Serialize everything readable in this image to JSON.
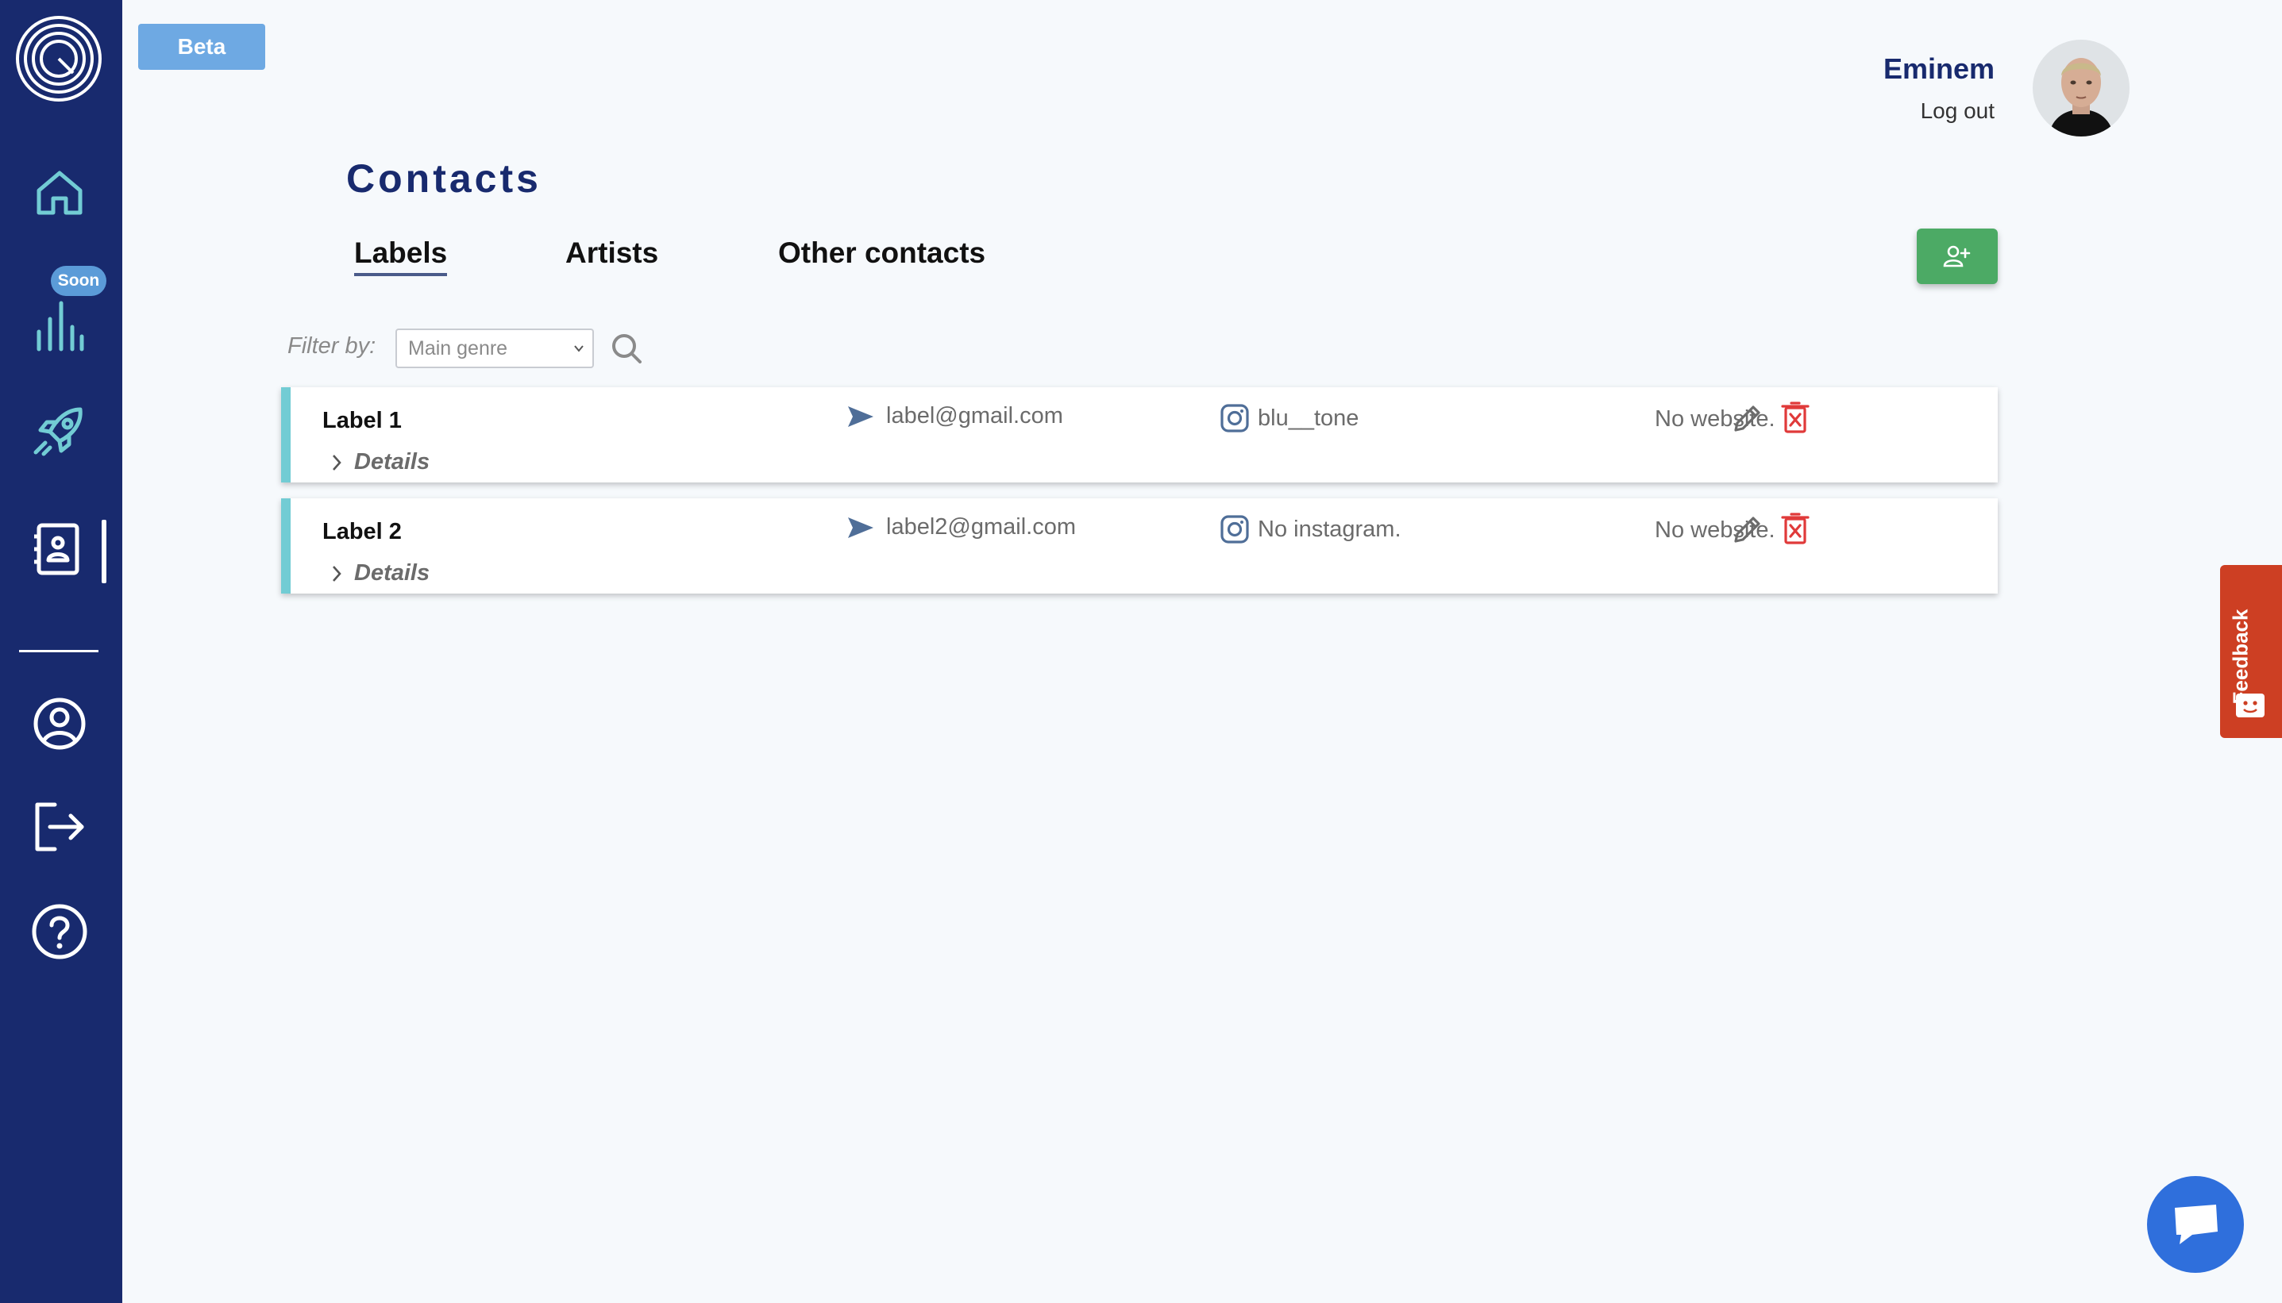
{
  "app": {
    "beta_label": "Beta",
    "page_title": "Contacts"
  },
  "user": {
    "name": "Eminem",
    "logout_label": "Log out"
  },
  "sidebar": {
    "soon_badge": "Soon",
    "items": [
      {
        "icon": "home-icon"
      },
      {
        "icon": "stats-icon",
        "badge": "Soon"
      },
      {
        "icon": "rocket-icon"
      },
      {
        "icon": "contacts-book-icon",
        "active": true
      },
      {
        "icon": "user-circle-icon"
      },
      {
        "icon": "logout-icon"
      },
      {
        "icon": "help-icon"
      }
    ]
  },
  "tabs": [
    {
      "label": "Labels",
      "active": true
    },
    {
      "label": "Artists",
      "active": false
    },
    {
      "label": "Other contacts",
      "active": false
    }
  ],
  "filter": {
    "label": "Filter by:",
    "select_value": "Main genre"
  },
  "contacts": [
    {
      "name": "Label 1",
      "details_label": "Details",
      "email": "label@gmail.com",
      "instagram": "blu__tone",
      "website": "No website."
    },
    {
      "name": "Label 2",
      "details_label": "Details",
      "email": "label2@gmail.com",
      "instagram": "No instagram.",
      "website": "No website."
    }
  ],
  "feedback": {
    "label": "Feedback"
  },
  "colors": {
    "sidebar": "#182a6e",
    "accent_teal": "#72ccd4",
    "add_button": "#4caa65",
    "beta": "#6ea9e3",
    "delete": "#e03a3a",
    "feedback": "#cd3f23",
    "chat": "#2f6fdc"
  }
}
